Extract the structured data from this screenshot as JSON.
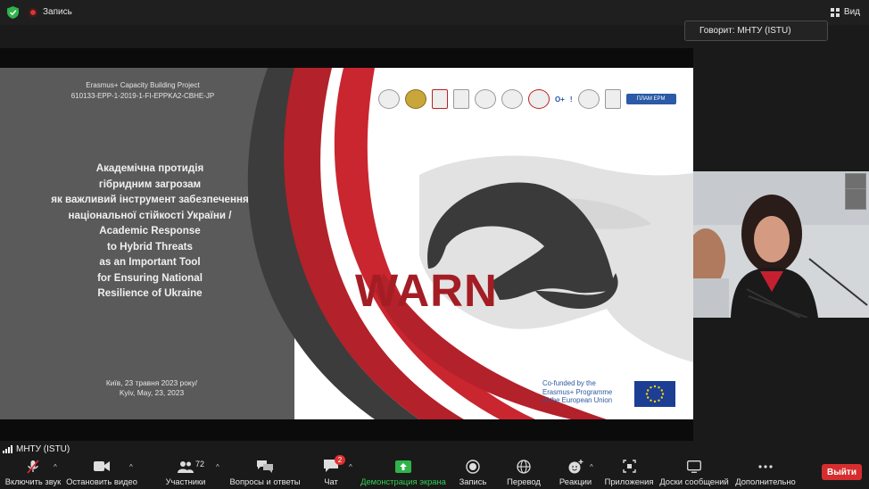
{
  "topbar": {
    "recording_label": "Запись",
    "view_label": "Вид"
  },
  "speaking": {
    "text": "Говорит: МНТУ (ISTU)"
  },
  "slide": {
    "project_lines": [
      "Erasmus+ Capacity Building Project",
      "610133-EPP-1-2019-1-FI-EPPKA2-CBHE-JP"
    ],
    "title_lines": [
      "Академічна протидія",
      "гібридним загрозам",
      "як важливий інструмент забезпечення",
      "національної стійкості України /",
      "Academic Response",
      "to Hybrid Threats",
      "as an Important Tool",
      "for Ensuring National",
      "Resilience of Ukraine"
    ],
    "date_lines": [
      "Київ, 23 травня 2023 року/",
      "Kyiv, May, 23, 2023"
    ],
    "logo_text": "WARN",
    "cofunded_lines": [
      "Co-funded by the",
      "Erasmus+ Programme",
      "of the European Union"
    ],
    "partner_logos": [
      "university-logo",
      "university-logo",
      "university-logo",
      "university-logo",
      "university-logo",
      "university-logo",
      "university-logo",
      "university-logo",
      "university-logo",
      "university-logo",
      "university-logo"
    ],
    "partner_text_logos": [
      "O+",
      "!",
      "ПЛАМ ЕРМ"
    ],
    "colors": {
      "red": "#a41d24",
      "grey": "#5a5a5a",
      "eu_blue": "#1c3f94"
    }
  },
  "participant": {
    "name": "МНТУ (ISTU)"
  },
  "toolbar": {
    "items": [
      {
        "label": "Включить звук",
        "icon": "microphone-muted-icon"
      },
      {
        "label": "Остановить видео",
        "icon": "video-camera-icon"
      },
      {
        "label": "Участники",
        "icon": "participants-icon",
        "count": "72"
      },
      {
        "label": "Вопросы и ответы",
        "icon": "qa-bubble-icon"
      },
      {
        "label": "Чат",
        "icon": "chat-icon",
        "badge": "2"
      },
      {
        "label": "Демонстрация экрана",
        "icon": "share-screen-icon"
      },
      {
        "label": "Запись",
        "icon": "record-icon"
      },
      {
        "label": "Перевод",
        "icon": "globe-icon"
      },
      {
        "label": "Реакции",
        "icon": "smiley-plus-icon"
      },
      {
        "label": "Приложения",
        "icon": "apps-icon"
      },
      {
        "label": "Доски сообщений",
        "icon": "whiteboard-icon"
      },
      {
        "label": "Дополнительно",
        "icon": "more-dots-icon"
      }
    ],
    "leave_label": "Выйти"
  }
}
